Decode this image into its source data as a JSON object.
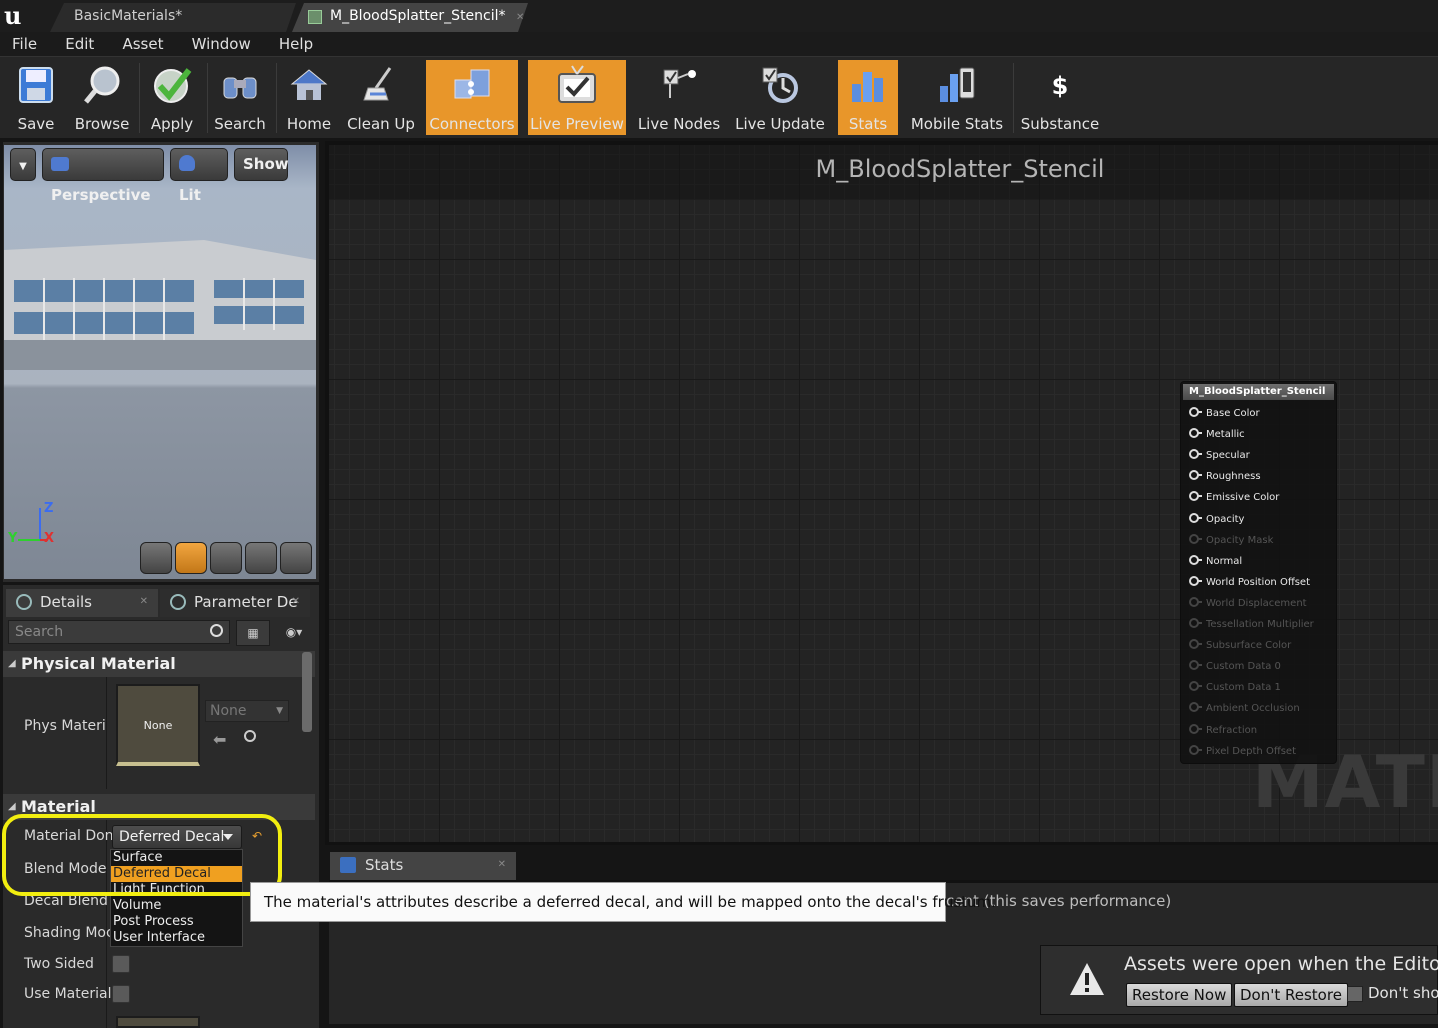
{
  "tabs": [
    {
      "label": "BasicMaterials*"
    },
    {
      "label": "M_BloodSplatter_Stencil*"
    }
  ],
  "menu": [
    "File",
    "Edit",
    "Asset",
    "Window",
    "Help"
  ],
  "toolbar": [
    {
      "label": "Save",
      "icon": "save-icon",
      "active": false
    },
    {
      "label": "Browse",
      "icon": "browse-icon",
      "active": false
    },
    {
      "label": "Apply",
      "icon": "apply-icon",
      "active": false
    },
    {
      "label": "Search",
      "icon": "search-icon",
      "active": false
    },
    {
      "label": "Home",
      "icon": "home-icon",
      "active": false
    },
    {
      "label": "Clean Up",
      "icon": "clean-up-icon",
      "active": false
    },
    {
      "label": "Connectors",
      "icon": "connectors-icon",
      "active": true
    },
    {
      "label": "Live Preview",
      "icon": "live-preview-icon",
      "active": true
    },
    {
      "label": "Live Nodes",
      "icon": "live-nodes-icon",
      "active": false
    },
    {
      "label": "Live Update",
      "icon": "live-update-icon",
      "active": false
    },
    {
      "label": "Stats",
      "icon": "stats-icon",
      "active": true
    },
    {
      "label": "Mobile Stats",
      "icon": "mobile-stats-icon",
      "active": false
    },
    {
      "label": "Substance",
      "icon": "substance-icon",
      "active": false
    }
  ],
  "viewport": {
    "perspective": "Perspective",
    "lit": "Lit",
    "show": "Show",
    "axis_z": "Z",
    "axis_y": "Y",
    "axis_x": "X"
  },
  "details": {
    "tab1": "Details",
    "tab2": "Parameter De",
    "search_placeholder": "Search",
    "physical_material_header": "Physical Material",
    "phys_material_label": "Phys Materi",
    "thumb_label": "None",
    "combo_none": "None",
    "material_header": "Material",
    "material_domain_label": "Material Don",
    "material_domain_value": "Deferred Decal",
    "blend_mode_label": "Blend Mode",
    "decal_blend_label": "Decal Blend",
    "shading_model_label": "Shading Moc",
    "two_sided_label": "Two Sided",
    "use_material_label": "Use Material"
  },
  "dropdown": {
    "options": [
      "Surface",
      "Deferred Decal",
      "Light Function",
      "Volume",
      "Post Process",
      "User Interface"
    ],
    "selected_index": 1
  },
  "tooltip": "The material's attributes describe a deferred decal, and will be mapped onto the decal's frustum.",
  "graph": {
    "title": "M_BloodSplatter_Stencil",
    "watermark": "MATEI",
    "node": {
      "title": "M_BloodSplatter_Stencil",
      "pins": [
        {
          "label": "Base Color",
          "enabled": true
        },
        {
          "label": "Metallic",
          "enabled": true
        },
        {
          "label": "Specular",
          "enabled": true
        },
        {
          "label": "Roughness",
          "enabled": true
        },
        {
          "label": "Emissive Color",
          "enabled": true
        },
        {
          "label": "Opacity",
          "enabled": true
        },
        {
          "label": "Opacity Mask",
          "enabled": false
        },
        {
          "label": "Normal",
          "enabled": true
        },
        {
          "label": "World Position Offset",
          "enabled": true
        },
        {
          "label": "World Displacement",
          "enabled": false
        },
        {
          "label": "Tessellation Multiplier",
          "enabled": false
        },
        {
          "label": "Subsurface Color",
          "enabled": false
        },
        {
          "label": "Custom Data 0",
          "enabled": false
        },
        {
          "label": "Custom Data 1",
          "enabled": false
        },
        {
          "label": "Ambient Occlusion",
          "enabled": false
        },
        {
          "label": "Refraction",
          "enabled": false
        },
        {
          "label": "Pixel Depth Offset",
          "enabled": false
        }
      ]
    }
  },
  "stats": {
    "tab": "Stats",
    "text": "cent (this saves performance)"
  },
  "notification": {
    "message": "Assets were open when the Editor wa",
    "restore": "Restore Now",
    "dont_restore": "Don't Restore",
    "dont_show": "Don't shov"
  },
  "colors": {
    "accent": "#e8962a",
    "highlight": "#f2ee10",
    "selection": "#f0a020"
  }
}
